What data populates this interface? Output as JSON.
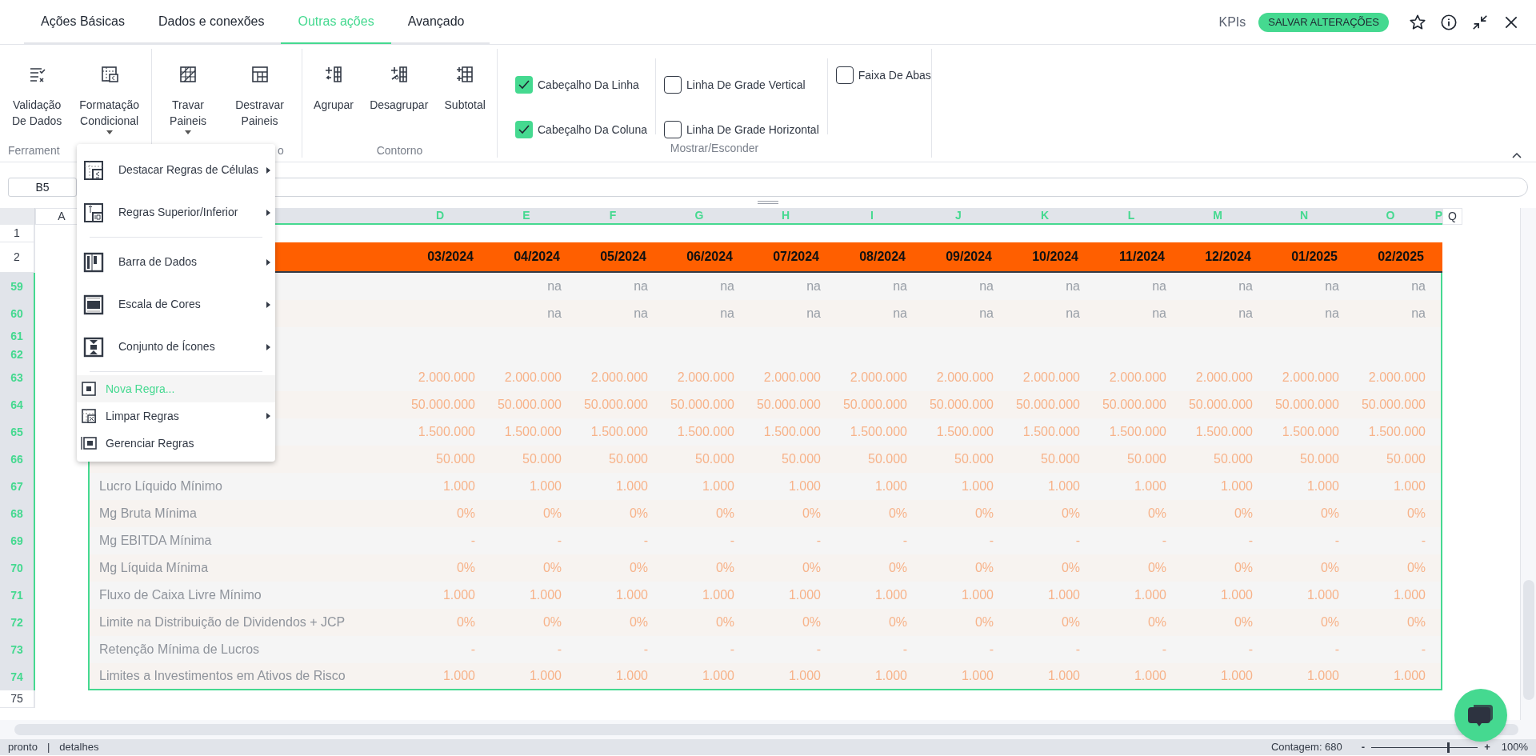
{
  "tabs": [
    {
      "label": "Ações Básicas",
      "selected": false
    },
    {
      "label": "Dados e conexões",
      "selected": false
    },
    {
      "label": "Outras ações",
      "selected": true
    },
    {
      "label": "Avançado",
      "selected": false
    }
  ],
  "header_actions": {
    "kpis": "KPIs",
    "save_button": "SALVAR ALTERAÇÕES"
  },
  "ribbon": {
    "groups": [
      {
        "label": "Ferrament",
        "buttons": [
          {
            "lines": [
              "Validação",
              "De Dados"
            ],
            "dropdown": false
          },
          {
            "lines": [
              "Formatação",
              "Condicional"
            ],
            "dropdown": true
          }
        ]
      },
      {
        "label": "o",
        "buttons": [
          {
            "lines": [
              "Travar",
              "Paineis"
            ],
            "dropdown": true
          },
          {
            "lines": [
              "Destravar",
              "Paineis"
            ],
            "dropdown": false
          }
        ]
      },
      {
        "label": "Contorno",
        "buttons": [
          {
            "lines": [
              "Agrupar"
            ],
            "dropdown": false
          },
          {
            "lines": [
              "Desagrupar"
            ],
            "dropdown": false
          },
          {
            "lines": [
              "Subtotal"
            ],
            "dropdown": false
          }
        ]
      },
      {
        "label": "Mostrar/Esconder",
        "checkbox_columns": [
          [
            {
              "label": "Cabeçalho Da Linha",
              "checked": true
            },
            {
              "label": "Cabeçalho Da Coluna",
              "checked": true
            }
          ],
          [
            {
              "label": "Linha De Grade Vertical",
              "checked": false
            },
            {
              "label": "Linha De Grade Horizontal",
              "checked": false
            }
          ],
          [
            {
              "label": "Faixa De Abas",
              "checked": false
            }
          ]
        ]
      }
    ]
  },
  "name_box": "B5",
  "columns": [
    {
      "label": "A",
      "selected": false
    },
    {
      "label": "D",
      "selected": true
    },
    {
      "label": "E",
      "selected": true
    },
    {
      "label": "F",
      "selected": true
    },
    {
      "label": "G",
      "selected": true
    },
    {
      "label": "H",
      "selected": true
    },
    {
      "label": "I",
      "selected": true
    },
    {
      "label": "J",
      "selected": true
    },
    {
      "label": "K",
      "selected": true
    },
    {
      "label": "L",
      "selected": true
    },
    {
      "label": "M",
      "selected": true
    },
    {
      "label": "N",
      "selected": true
    },
    {
      "label": "O",
      "selected": true
    },
    {
      "label": "P",
      "selected": true
    },
    {
      "label": "Q",
      "selected": false
    }
  ],
  "rows": [
    {
      "number": "1",
      "kind": "blank",
      "selected": false
    },
    {
      "number": "2",
      "kind": "header",
      "selected": false,
      "values": [
        "03/2024",
        "04/2024",
        "05/2024",
        "06/2024",
        "07/2024",
        "08/2024",
        "09/2024",
        "10/2024",
        "11/2024",
        "12/2024",
        "01/2025",
        "02/2025"
      ]
    },
    {
      "number": "59",
      "kind": "data",
      "selected": true,
      "values": [
        "na",
        "na",
        "na",
        "na",
        "na",
        "na",
        "na",
        "na",
        "na",
        "na",
        "na"
      ]
    },
    {
      "number": "60",
      "kind": "data",
      "selected": true,
      "values": [
        "na",
        "na",
        "na",
        "na",
        "na",
        "na",
        "na",
        "na",
        "na",
        "na",
        "na"
      ]
    },
    {
      "number": "61",
      "kind": "short",
      "selected": true
    },
    {
      "number": "62",
      "kind": "short",
      "selected": true
    },
    {
      "number": "63",
      "kind": "data",
      "selected": true,
      "values": [
        "2.000.000",
        "2.000.000",
        "2.000.000",
        "2.000.000",
        "2.000.000",
        "2.000.000",
        "2.000.000",
        "2.000.000",
        "2.000.000",
        "2.000.000",
        "2.000.000",
        "2.000.000"
      ]
    },
    {
      "number": "64",
      "kind": "data",
      "selected": true,
      "values": [
        "50.000.000",
        "50.000.000",
        "50.000.000",
        "50.000.000",
        "50.000.000",
        "50.000.000",
        "50.000.000",
        "50.000.000",
        "50.000.000",
        "50.000.000",
        "50.000.000",
        "50.000.000"
      ]
    },
    {
      "number": "65",
      "kind": "data",
      "selected": true,
      "values": [
        "1.500.000",
        "1.500.000",
        "1.500.000",
        "1.500.000",
        "1.500.000",
        "1.500.000",
        "1.500.000",
        "1.500.000",
        "1.500.000",
        "1.500.000",
        "1.500.000",
        "1.500.000"
      ]
    },
    {
      "number": "66",
      "kind": "data",
      "selected": true,
      "values": [
        "50.000",
        "50.000",
        "50.000",
        "50.000",
        "50.000",
        "50.000",
        "50.000",
        "50.000",
        "50.000",
        "50.000",
        "50.000",
        "50.000"
      ]
    },
    {
      "number": "67",
      "kind": "data",
      "selected": true,
      "label": "Lucro Líquido Mínimo",
      "values": [
        "1.000",
        "1.000",
        "1.000",
        "1.000",
        "1.000",
        "1.000",
        "1.000",
        "1.000",
        "1.000",
        "1.000",
        "1.000",
        "1.000"
      ]
    },
    {
      "number": "68",
      "kind": "data",
      "selected": true,
      "label": "Mg Bruta Mínima",
      "values": [
        "0%",
        "0%",
        "0%",
        "0%",
        "0%",
        "0%",
        "0%",
        "0%",
        "0%",
        "0%",
        "0%",
        "0%"
      ]
    },
    {
      "number": "69",
      "kind": "data",
      "selected": true,
      "label": "Mg EBITDA Mínima",
      "values": [
        "-",
        "-",
        "-",
        "-",
        "-",
        "-",
        "-",
        "-",
        "-",
        "-",
        "-",
        "-"
      ]
    },
    {
      "number": "70",
      "kind": "data",
      "selected": true,
      "label": "Mg Líquida Mínima",
      "values": [
        "0%",
        "0%",
        "0%",
        "0%",
        "0%",
        "0%",
        "0%",
        "0%",
        "0%",
        "0%",
        "0%",
        "0%"
      ]
    },
    {
      "number": "71",
      "kind": "data",
      "selected": true,
      "label": "Fluxo de Caixa Livre Mínimo",
      "values": [
        "1.000",
        "1.000",
        "1.000",
        "1.000",
        "1.000",
        "1.000",
        "1.000",
        "1.000",
        "1.000",
        "1.000",
        "1.000",
        "1.000"
      ]
    },
    {
      "number": "72",
      "kind": "data",
      "selected": true,
      "label": "Limite na Distribuição de Dividendos + JCP",
      "values": [
        "0%",
        "0%",
        "0%",
        "0%",
        "0%",
        "0%",
        "0%",
        "0%",
        "0%",
        "0%",
        "0%",
        "0%"
      ]
    },
    {
      "number": "73",
      "kind": "data",
      "selected": true,
      "label": "Retenção Mínima de Lucros",
      "values": [
        "-",
        "-",
        "-",
        "-",
        "-",
        "-",
        "-",
        "-",
        "-",
        "-",
        "-",
        "-"
      ]
    },
    {
      "number": "74",
      "kind": "data",
      "selected": true,
      "label": "Limites a Investimentos em Ativos de Risco",
      "values": [
        "1.000",
        "1.000",
        "1.000",
        "1.000",
        "1.000",
        "1.000",
        "1.000",
        "1.000",
        "1.000",
        "1.000",
        "1.000",
        "1.000"
      ]
    },
    {
      "number": "75",
      "kind": "blank",
      "selected": false
    }
  ],
  "context_menu": [
    {
      "kind": "large",
      "label": "Destacar Regras de Células",
      "submenu": true,
      "highlighted": false
    },
    {
      "kind": "large",
      "label": "Regras Superior/Inferior",
      "submenu": true,
      "highlighted": false
    },
    {
      "kind": "separator"
    },
    {
      "kind": "large",
      "label": "Barra de Dados",
      "submenu": true,
      "highlighted": false
    },
    {
      "kind": "large",
      "label": "Escala de Cores",
      "submenu": true,
      "highlighted": false
    },
    {
      "kind": "large",
      "label": "Conjunto de Ícones",
      "submenu": true,
      "highlighted": false
    },
    {
      "kind": "separator"
    },
    {
      "kind": "small",
      "label": "Nova Regra...",
      "submenu": false,
      "highlighted": true
    },
    {
      "kind": "small",
      "label": "Limpar Regras",
      "submenu": true,
      "highlighted": false
    },
    {
      "kind": "small",
      "label": "Gerenciar Regras",
      "submenu": false,
      "highlighted": false
    }
  ],
  "status_bar": {
    "mode": "pronto",
    "separator": "|",
    "details": "detalhes",
    "count": "Contagem: 680",
    "zoom_minus": "-",
    "zoom_plus": "+",
    "zoom_level": {
      "level": 0.73
    },
    "zoom": "100%"
  }
}
